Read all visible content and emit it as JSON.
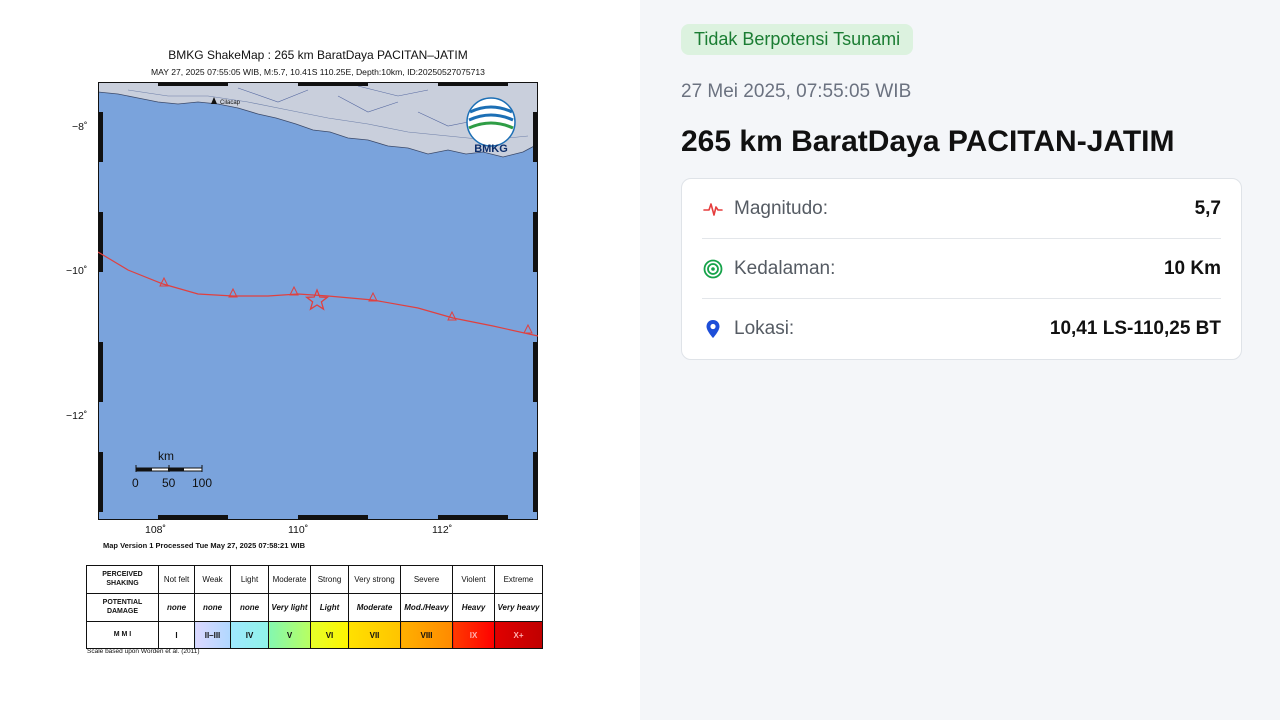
{
  "shakemap": {
    "title": "BMKG ShakeMap : 265 km BaratDaya PACITAN–JATIM",
    "subtitle": "MAY 27, 2025 07:55:05 WIB, M:5.7, 10.41S 110.25E, Depth:10km, ID:20250527075713",
    "lat_labels": [
      "−8˚",
      "−10˚",
      "−12˚"
    ],
    "lon_labels": [
      "108˚",
      "110˚",
      "112˚"
    ],
    "logo_text": "BMKG",
    "city_label": "Cilacap",
    "scale_bar": {
      "unit": "km",
      "ticks": [
        "0",
        "50",
        "100"
      ]
    },
    "processed_note": "Map Version 1 Processed Tue May 27, 2025 07:58:21 WIB",
    "legend": {
      "row_headers": [
        "PERCEIVED SHAKING",
        "POTENTIAL DAMAGE",
        "M M I"
      ],
      "shaking": [
        "Not felt",
        "Weak",
        "Light",
        "Moderate",
        "Strong",
        "Very strong",
        "Severe",
        "Violent",
        "Extreme"
      ],
      "damage": [
        "none",
        "none",
        "none",
        "Very light",
        "Light",
        "Moderate",
        "Mod./Heavy",
        "Heavy",
        "Very heavy"
      ],
      "mmi": [
        "I",
        "II–III",
        "IV",
        "V",
        "VI",
        "VII",
        "VIII",
        "IX",
        "X+"
      ],
      "mmi_colors": [
        "#ffffff",
        "#bfccff",
        "#a0e6ff",
        "#80ffaa",
        "#fff700",
        "#ffc800",
        "#ff9100",
        "#ff0000",
        "#c80000"
      ]
    },
    "scale_note": "Scale based upon Worden et al. (2011)"
  },
  "event": {
    "tsunami_badge": "Tidak Berpotensi Tsunami",
    "datetime": "27 Mei 2025, 07:55:05 WIB",
    "location_title": "265 km BaratDaya PACITAN-JATIM",
    "details": [
      {
        "label": "Magnitudo:",
        "value": "5,7",
        "icon": "pulse-icon",
        "color": "#e53e3e"
      },
      {
        "label": "Kedalaman:",
        "value": "10 Km",
        "icon": "target-icon",
        "color": "#16a34a"
      },
      {
        "label": "Lokasi:",
        "value": "10,41 LS-110,25 BT",
        "icon": "map-pin-icon",
        "color": "#1d4ed8"
      }
    ]
  },
  "colors": {
    "sea": "#7aa3dc",
    "land": "#c9cfdc",
    "trench": "#e0403f",
    "badge_bg": "#dcf2df",
    "badge_text": "#1b7d33"
  }
}
